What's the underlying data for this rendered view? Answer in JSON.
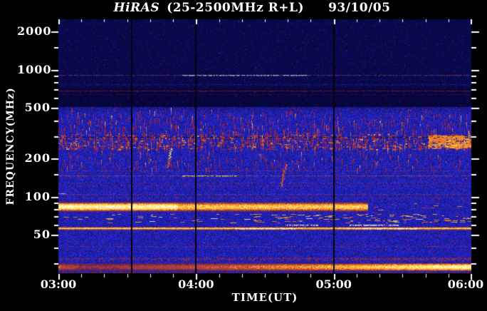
{
  "header": {
    "instrument": "HiRAS",
    "params": "(25-2500MHz R+L)",
    "date": "93/10/05"
  },
  "axes": {
    "x_label": "TIME(UT)",
    "y_label": "FREQUENCY(MHz)"
  },
  "chart_data": {
    "type": "heatmap",
    "subtype": "radio-dynamic-spectrum",
    "title": "HiRAS (25-2500MHz R+L)",
    "date": "93/10/05",
    "xlabel": "TIME(UT)",
    "ylabel": "FREQUENCY(MHz)",
    "x_start_ut": "03:00",
    "x_end_ut": "06:00",
    "x_major_ticks": [
      "03:00",
      "04:00",
      "05:00",
      "06:00"
    ],
    "x_minor_tick_minutes": 10,
    "y_scale": "log",
    "y_range_mhz": [
      25,
      2500
    ],
    "y_major_ticks_mhz": [
      2000,
      1000,
      500,
      200,
      100,
      50
    ],
    "y_minor_ticks_mhz": [
      1500,
      900,
      800,
      700,
      600,
      400,
      300,
      150,
      90,
      80,
      70,
      60,
      40,
      30
    ],
    "data_gap_lines_ut": [
      "03:32",
      "04:00",
      "05:00"
    ],
    "seam_lines_mhz": [
      295
    ],
    "palette": {
      "frame_background": "#000000",
      "text": "#FFFFFF",
      "quiet_high_band": "#000060",
      "quiet_low_band": "#16169B",
      "weak": "#AA2310",
      "medium": "#D74B14",
      "strong": "#FA9623",
      "intense": "#FFD750",
      "saturated": "#FFFAC8"
    },
    "interference_lines": [
      {
        "f_mhz": 912,
        "color": "#C85A6E",
        "strength": 0.5,
        "gap_prob": 0.15
      },
      {
        "f_mhz": 770,
        "color": "#5A46C8",
        "strength": 0.35,
        "gap_prob": 0.3
      },
      {
        "f_mhz": 690,
        "color": "#C82814",
        "strength": 0.6,
        "gap_prob": 0.12
      },
      {
        "f_mhz": 640,
        "color": "#96283C",
        "strength": 0.3,
        "gap_prob": 0.35
      },
      {
        "f_mhz": 160,
        "color": "#D23C14",
        "strength": 0.5,
        "gap_prob": 0.45
      },
      {
        "f_mhz": 148,
        "color": "#E05A14",
        "strength": 0.6,
        "gap_prob": 0.2
      },
      {
        "f_mhz": 130,
        "color": "#C83214",
        "strength": 0.45,
        "gap_prob": 0.5
      },
      {
        "f_mhz": 122,
        "color": "#C83214",
        "strength": 0.4,
        "gap_prob": 0.5
      },
      {
        "f_mhz": 105,
        "color": "#D24114",
        "strength": 0.55,
        "gap_prob": 0.35
      },
      {
        "f_mhz": 99,
        "color": "#C83214",
        "strength": 0.45,
        "gap_prob": 0.4
      },
      {
        "f_mhz": 41,
        "color": "#D23C14",
        "strength": 0.55,
        "gap_prob": 0.45
      },
      {
        "f_mhz": 33,
        "color": "#D23C14",
        "strength": 0.5,
        "gap_prob": 0.4
      }
    ],
    "bright_segments": [
      {
        "f_mhz": 912,
        "start_ut": "03:54",
        "end_ut": "04:48",
        "color": "gray"
      },
      {
        "f_mhz": 148,
        "start_ut": "03:54",
        "end_ut": "04:18",
        "color": "yellow"
      },
      {
        "f_mhz": 107,
        "start_ut": "03:00",
        "end_ut": "03:03",
        "color": "gray"
      },
      {
        "f_mhz": 60,
        "start_ut": "04:39",
        "end_ut": "04:53",
        "color": "white"
      },
      {
        "f_mhz": 60,
        "start_ut": "05:07",
        "end_ut": "05:28",
        "color": "white"
      },
      {
        "f_mhz": 56.5,
        "start_ut": "04:17",
        "end_ut": "04:43",
        "color": "white"
      },
      {
        "f_mhz": 56.5,
        "start_ut": "05:06",
        "end_ut": "05:37",
        "color": "white"
      }
    ],
    "emission_bands": [
      {
        "f_hi_mhz": 500,
        "f_lo_mhz": 240,
        "type": "burst-streaks",
        "density": 1.5
      },
      {
        "f_hi_mhz": 310,
        "f_lo_mhz": 235,
        "type": "burst-blotches",
        "density": 1.4,
        "enhanced_after_ut": "05:41"
      },
      {
        "f_hi_mhz": 235,
        "f_lo_mhz": 165,
        "type": "burst-streaks",
        "density": 0.35
      },
      {
        "f_hi_mhz": 92,
        "f_lo_mhz": 76,
        "type": "broadcast-band",
        "strong_until_ut": "03:52",
        "fades_after_ut": "05:15"
      },
      {
        "f_hi_mhz": 73,
        "f_lo_mhz": 62,
        "type": "dash-band",
        "density": 0.5
      },
      {
        "f_hi_mhz": 58,
        "f_lo_mhz": 55,
        "type": "saturated-line"
      },
      {
        "f_hi_mhz": 33.5,
        "f_lo_mhz": 31,
        "type": "speckle-band",
        "density": 0.6
      },
      {
        "f_hi_mhz": 30.5,
        "f_lo_mhz": 26,
        "type": "bottom-band",
        "ramp_toward_ut": "06:00"
      }
    ],
    "burst_features": [
      {
        "time_ut": "03:49",
        "f_hi_mhz": 240,
        "f_lo_mhz": 170,
        "type": "drifting-burst"
      },
      {
        "time_ut": "04:39",
        "f_hi_mhz": 180,
        "f_lo_mhz": 120,
        "type": "vertical-streak"
      }
    ]
  }
}
